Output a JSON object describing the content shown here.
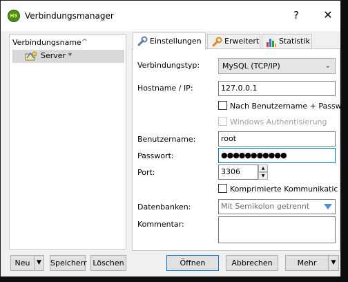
{
  "window": {
    "title": "Verbindungsmanager",
    "app_icon_text": "HS",
    "help": "?",
    "close": "✕"
  },
  "tree": {
    "header": "Verbindungsname",
    "sort_indicator": "^",
    "items": [
      {
        "label": "Server *",
        "icon": "server-icon",
        "selected": true
      }
    ]
  },
  "tabs": [
    {
      "label": "Einstellungen",
      "icon": "wrench-icon",
      "active": true
    },
    {
      "label": "Erweitert",
      "icon": "wrench-orange-icon",
      "active": false
    },
    {
      "label": "Statistik",
      "icon": "bar-chart-icon",
      "active": false
    }
  ],
  "settings": {
    "type_label": "Verbindungstyp:",
    "type_value": "MySQL (TCP/IP)",
    "host_label": "Hostname / IP:",
    "host_value": "127.0.0.1",
    "prompt_checkbox": "Nach Benutzername + Passw",
    "windows_auth_checkbox": "Windows Authentisierung",
    "user_label": "Benutzername:",
    "user_value": "root",
    "password_label": "Passwort:",
    "password_value": "●●●●●●●●●●●",
    "port_label": "Port:",
    "port_value": "3306",
    "compressed_checkbox": "Komprimierte Kommunikatic",
    "databases_label": "Datenbanken:",
    "databases_placeholder": "Mit Semikolon getrennt",
    "comment_label": "Kommentar:",
    "comment_value": ""
  },
  "buttons": {
    "new": "Neu",
    "save": "Speicherr",
    "delete": "Löschen",
    "open": "Öffnen",
    "cancel": "Abbrechen",
    "more": "Mehr",
    "dropdown_arrow": "▼",
    "spin_up": "▲",
    "spin_down": "▼",
    "select_arrow": "⌄"
  },
  "colors": {
    "accent_blue": "#0078d7",
    "selection_gray": "#d9d9d9",
    "app_icon_green": "#4d8f1f"
  }
}
